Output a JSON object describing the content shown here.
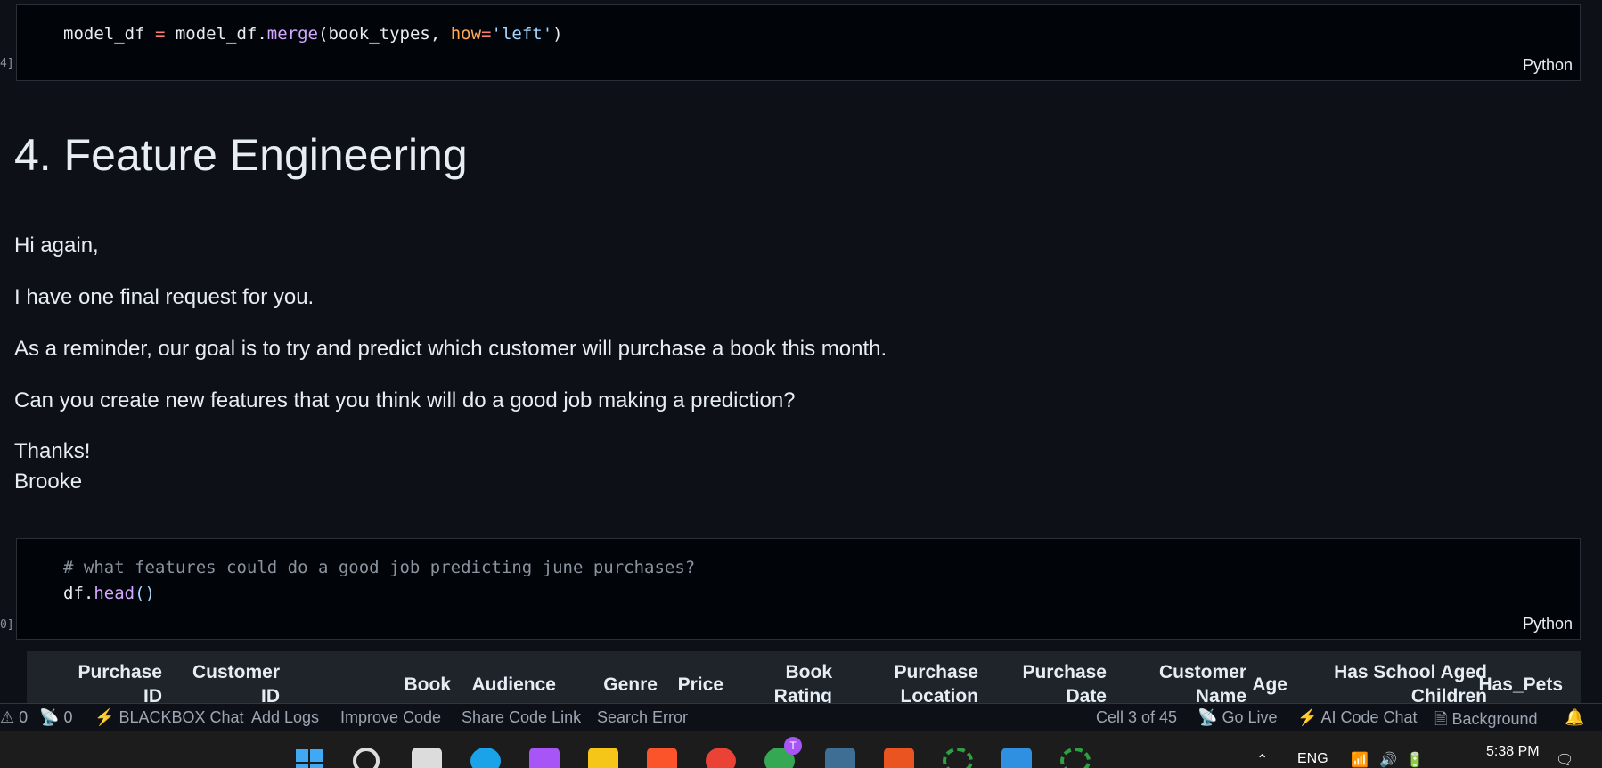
{
  "cells": {
    "merge": {
      "index": "4]",
      "lang": "Python",
      "code": {
        "var": "model_df",
        "eq": " = ",
        "obj": "model_df.",
        "fn": "merge",
        "open": "(book_types, ",
        "kw": "how",
        "eq2": "=",
        "str": "'left'",
        "close": ")"
      }
    },
    "markdown": {
      "heading": "4. Feature Engineering",
      "p1": "Hi again,",
      "p2": "I have one final request for you.",
      "p3": "As a reminder, our goal is to try and predict which customer will purchase a book this month.",
      "p4": "Can you create new features that you think will do a good job making a prediction?",
      "p5": "Thanks!",
      "p6": "Brooke"
    },
    "head": {
      "index": "0]",
      "lang": "Python",
      "comment": "# what features could do a good job predicting june purchases?",
      "obj": "df.",
      "fn": "head",
      "call": "()"
    }
  },
  "table_headers": [
    {
      "l1": "Purchase",
      "l2": "ID"
    },
    {
      "l1": "Customer",
      "l2": "ID"
    },
    {
      "l1": "Book",
      "l2": ""
    },
    {
      "l1": "Audience",
      "l2": ""
    },
    {
      "l1": "Genre",
      "l2": ""
    },
    {
      "l1": "Price",
      "l2": ""
    },
    {
      "l1": "Book",
      "l2": "Rating"
    },
    {
      "l1": "Purchase",
      "l2": "Location"
    },
    {
      "l1": "Purchase",
      "l2": "Date"
    },
    {
      "l1": "Customer",
      "l2": "Name"
    },
    {
      "l1": "Age",
      "l2": ""
    },
    {
      "l1": "Has School Aged",
      "l2": "Children"
    },
    {
      "l1": "Has_Pets",
      "l2": ""
    }
  ],
  "statusbar": {
    "errors": "0",
    "ports": "0",
    "blackbox": "BLACKBOX Chat",
    "add_logs": "Add Logs",
    "improve": "Improve Code",
    "share": "Share Code Link",
    "search_error": "Search Error",
    "cell": "Cell 3 of 45",
    "go_live": "Go Live",
    "ai_chat": "AI Code Chat",
    "background": "Background"
  },
  "taskbar": {
    "lang": "ENG",
    "time": "5:38 PM",
    "badge": "T"
  },
  "colors": {
    "accent_orange": "#f97316",
    "vscode_blue": "#2f8fe0"
  }
}
